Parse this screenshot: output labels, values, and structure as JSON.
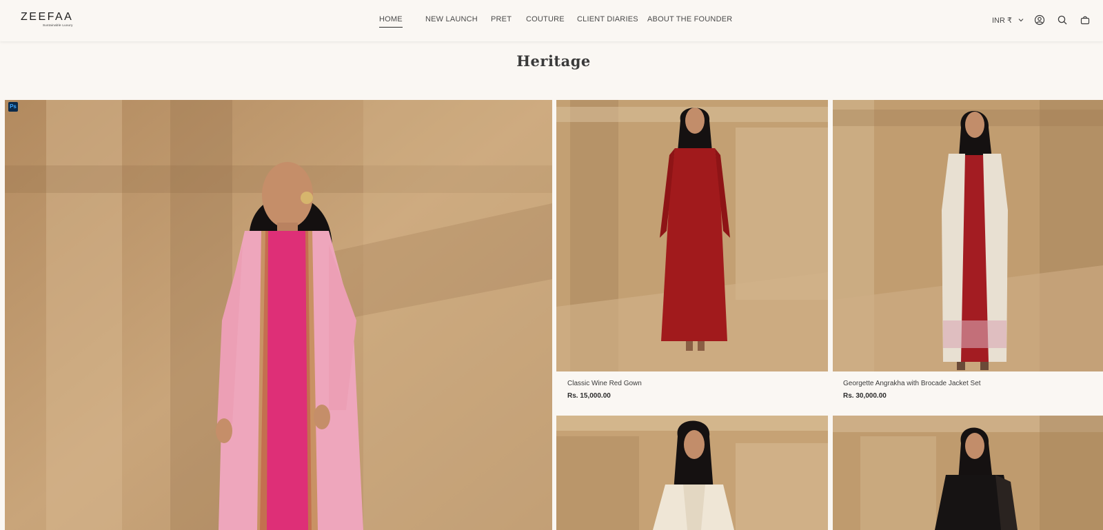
{
  "header": {
    "logo": {
      "brand": "ZEEFAA",
      "tagline": "Sustainable Luxury"
    },
    "nav": [
      {
        "label": "HOME",
        "active": true
      },
      {
        "label": "NEW LAUNCH",
        "active": false
      },
      {
        "label": "PRET",
        "active": false
      },
      {
        "label": "COUTURE",
        "active": false
      },
      {
        "label": "CLIENT DIARIES",
        "active": false
      },
      {
        "label": "ABOUT THE FOUNDER",
        "active": false
      }
    ],
    "currency": "INR ₹",
    "icons": [
      "account-icon",
      "search-icon",
      "cart-icon"
    ]
  },
  "page": {
    "title": "Heritage"
  },
  "badge": "Ps",
  "products": [
    {
      "name": "Classic Wine Red Gown",
      "price": "Rs. 15,000.00",
      "garment_color": "#a11a1c"
    },
    {
      "name": "Georgette Angrakha with Brocade Jacket Set",
      "price": "Rs. 30,000.00",
      "garment_color": "#e8e0d2"
    }
  ],
  "colors": {
    "background": "#faf7f3",
    "backdrop": "#c9a679",
    "feature_jacket": "#eea6bc",
    "feature_inner": "#de2f77"
  }
}
